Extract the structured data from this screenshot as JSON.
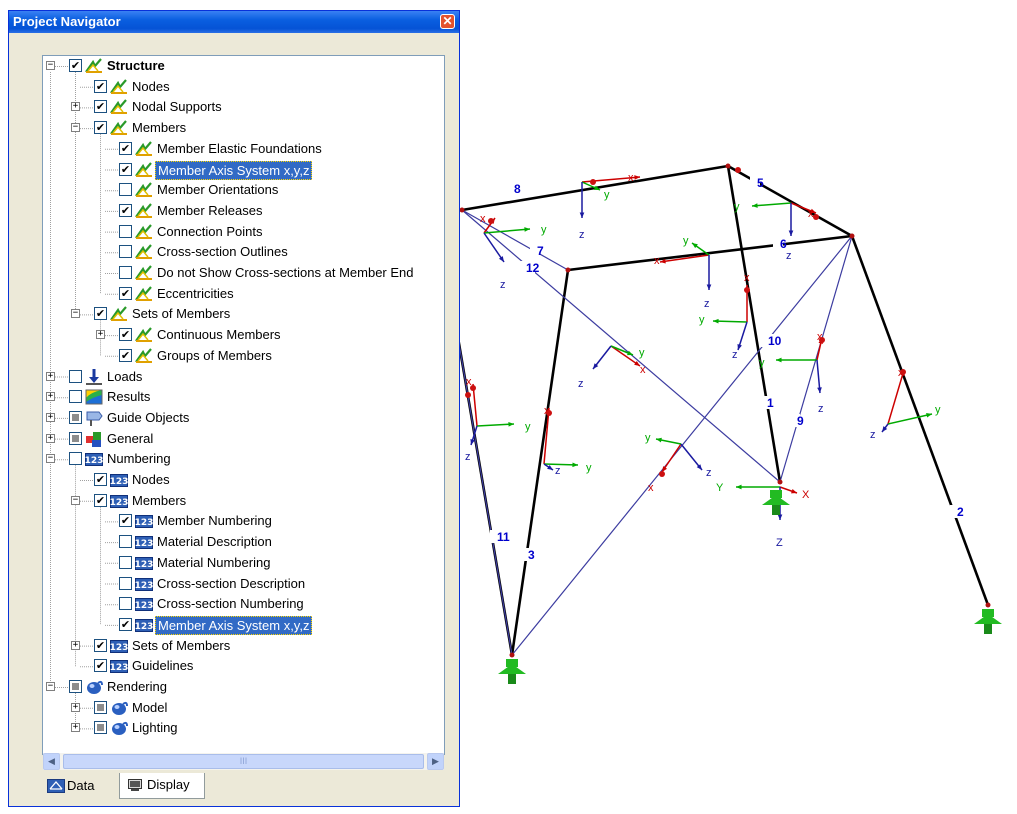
{
  "window": {
    "title": "Project Navigator",
    "close_glyph": "✕"
  },
  "tree": [
    {
      "label": "Structure",
      "level": 1,
      "expander": "minus",
      "check": "checked",
      "icon": "structure-icon",
      "bold": true
    },
    {
      "label": "Nodes",
      "level": 2,
      "expander": "none",
      "check": "checked",
      "icon": "structure-icon"
    },
    {
      "label": "Nodal Supports",
      "level": 2,
      "expander": "plus",
      "check": "checked",
      "icon": "structure-icon"
    },
    {
      "label": "Members",
      "level": 2,
      "expander": "minus",
      "check": "checked",
      "icon": "structure-icon"
    },
    {
      "label": "Member Elastic Foundations",
      "level": 3,
      "expander": "none",
      "check": "checked",
      "icon": "structure-icon"
    },
    {
      "label": "Member Axis System x,y,z",
      "level": 3,
      "expander": "none",
      "check": "checked",
      "icon": "structure-icon",
      "selected": true
    },
    {
      "label": "Member Orientations",
      "level": 3,
      "expander": "none",
      "check": "unchecked",
      "icon": "structure-icon"
    },
    {
      "label": "Member Releases",
      "level": 3,
      "expander": "none",
      "check": "checked",
      "icon": "structure-icon"
    },
    {
      "label": "Connection Points",
      "level": 3,
      "expander": "none",
      "check": "unchecked",
      "icon": "structure-icon"
    },
    {
      "label": "Cross-section Outlines",
      "level": 3,
      "expander": "none",
      "check": "unchecked",
      "icon": "structure-icon"
    },
    {
      "label": "Do not Show Cross-sections at Member End",
      "level": 3,
      "expander": "none",
      "check": "unchecked",
      "icon": "structure-icon"
    },
    {
      "label": "Eccentricities",
      "level": 3,
      "expander": "none",
      "check": "checked",
      "icon": "structure-icon"
    },
    {
      "label": "Sets of Members",
      "level": 2,
      "expander": "minus",
      "check": "checked",
      "icon": "structure-icon"
    },
    {
      "label": "Continuous Members",
      "level": 3,
      "expander": "plus",
      "check": "checked",
      "icon": "structure-icon"
    },
    {
      "label": "Groups of Members",
      "level": 3,
      "expander": "none",
      "check": "checked",
      "icon": "structure-icon"
    },
    {
      "label": "Loads",
      "level": 1,
      "expander": "plus",
      "check": "unchecked",
      "icon": "loads-icon"
    },
    {
      "label": "Results",
      "level": 1,
      "expander": "plus",
      "check": "unchecked",
      "icon": "results-icon"
    },
    {
      "label": "Guide Objects",
      "level": 1,
      "expander": "plus",
      "check": "partial",
      "icon": "guide-objects-icon"
    },
    {
      "label": "General",
      "level": 1,
      "expander": "plus",
      "check": "partial",
      "icon": "general-icon"
    },
    {
      "label": "Numbering",
      "level": 1,
      "expander": "minus",
      "check": "unchecked",
      "icon": "numbering-icon"
    },
    {
      "label": "Nodes",
      "level": 2,
      "expander": "none",
      "check": "checked",
      "icon": "numbering-icon"
    },
    {
      "label": "Members",
      "level": 2,
      "expander": "minus",
      "check": "checked",
      "icon": "numbering-icon"
    },
    {
      "label": "Member Numbering",
      "level": 3,
      "expander": "none",
      "check": "checked",
      "icon": "numbering-icon"
    },
    {
      "label": "Material Description",
      "level": 3,
      "expander": "none",
      "check": "unchecked",
      "icon": "numbering-icon"
    },
    {
      "label": "Material Numbering",
      "level": 3,
      "expander": "none",
      "check": "unchecked",
      "icon": "numbering-icon"
    },
    {
      "label": "Cross-section Description",
      "level": 3,
      "expander": "none",
      "check": "unchecked",
      "icon": "numbering-icon"
    },
    {
      "label": "Cross-section Numbering",
      "level": 3,
      "expander": "none",
      "check": "unchecked",
      "icon": "numbering-icon"
    },
    {
      "label": "Member Axis System x,y,z",
      "level": 3,
      "expander": "none",
      "check": "checked",
      "icon": "numbering-icon",
      "selected": true
    },
    {
      "label": "Sets of Members",
      "level": 2,
      "expander": "plus",
      "check": "checked",
      "icon": "numbering-icon"
    },
    {
      "label": "Guidelines",
      "level": 2,
      "expander": "none",
      "check": "checked",
      "icon": "numbering-icon"
    },
    {
      "label": "Rendering",
      "level": 1,
      "expander": "minus",
      "check": "partial",
      "icon": "rendering-icon"
    },
    {
      "label": "Model",
      "level": 2,
      "expander": "plus",
      "check": "partial",
      "icon": "rendering-icon"
    },
    {
      "label": "Lighting",
      "level": 2,
      "expander": "plus",
      "check": "partial",
      "icon": "rendering-icon"
    }
  ],
  "scrollbar": {
    "left_glyph": "◀",
    "right_glyph": "▶",
    "thumb_glyph": "III"
  },
  "tabs": [
    {
      "label": "Data",
      "icon": "data-tab-icon"
    },
    {
      "label": "Display",
      "icon": "display-tab-icon",
      "active": true
    }
  ],
  "model": {
    "member_numbers": [
      "1",
      "2",
      "3",
      "5",
      "6",
      "7",
      "8",
      "9",
      "10",
      "11",
      "12"
    ],
    "axis_labels": {
      "x": "x",
      "y": "y",
      "z": "z",
      "global_x": "X",
      "global_y": "Y",
      "global_z": "Z"
    },
    "colors": {
      "member": "#000000",
      "brace": "#3c3ca0",
      "number": "#0000cc",
      "x_axis": "#cc0000",
      "y_axis": "#00aa00",
      "z_axis": "#1a1aa0",
      "support": "#22bb22"
    }
  }
}
